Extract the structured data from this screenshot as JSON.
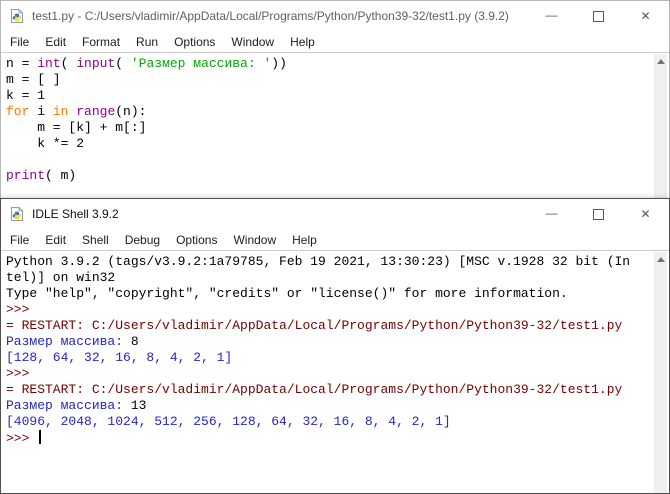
{
  "colors": {
    "plain": "#000000",
    "keyword": "#ff7700",
    "builtin": "#900090",
    "string": "#00aa00",
    "stdout": "#2525cd",
    "console": "#770000"
  },
  "editor_window": {
    "title": "test1.py - C:/Users/vladimir/AppData/Local/Programs/Python/Python39-32/test1.py (3.9.2)",
    "menu": [
      "File",
      "Edit",
      "Format",
      "Run",
      "Options",
      "Window",
      "Help"
    ],
    "controls": {
      "minimize": "—",
      "close": "✕"
    },
    "code_lines": [
      [
        {
          "t": "n = ",
          "c": "plain"
        },
        {
          "t": "int",
          "c": "builtin"
        },
        {
          "t": "( ",
          "c": "plain"
        },
        {
          "t": "input",
          "c": "builtin"
        },
        {
          "t": "( ",
          "c": "plain"
        },
        {
          "t": "'Размер массива: '",
          "c": "string"
        },
        {
          "t": "))",
          "c": "plain"
        }
      ],
      [
        {
          "t": "m = [ ]",
          "c": "plain"
        }
      ],
      [
        {
          "t": "k = 1",
          "c": "plain"
        }
      ],
      [
        {
          "t": "for",
          "c": "kw"
        },
        {
          "t": " i ",
          "c": "plain"
        },
        {
          "t": "in",
          "c": "kw"
        },
        {
          "t": " ",
          "c": "plain"
        },
        {
          "t": "range",
          "c": "builtin"
        },
        {
          "t": "(n):",
          "c": "plain"
        }
      ],
      [
        {
          "t": "    m = [k] + m[:]",
          "c": "plain"
        }
      ],
      [
        {
          "t": "    k *= 2",
          "c": "plain"
        }
      ],
      [
        {
          "t": "",
          "c": "plain"
        }
      ],
      [
        {
          "t": "print",
          "c": "builtin"
        },
        {
          "t": "( m)",
          "c": "plain"
        }
      ]
    ]
  },
  "shell_window": {
    "title": "IDLE Shell 3.9.2",
    "menu": [
      "File",
      "Edit",
      "Shell",
      "Debug",
      "Options",
      "Window",
      "Help"
    ],
    "controls": {
      "minimize": "—",
      "close": "✕"
    },
    "lines": [
      [
        {
          "t": "Python 3.9.2 (tags/v3.9.2:1a79785, Feb 19 2021, 13:30:23) [MSC v.1928 32 bit (In",
          "c": "plain"
        }
      ],
      [
        {
          "t": "tel)] on win32",
          "c": "plain"
        }
      ],
      [
        {
          "t": "Type \"help\", \"copyright\", \"credits\" or \"license()\" for more information.",
          "c": "plain"
        }
      ],
      [
        {
          "t": ">>> ",
          "c": "console"
        }
      ],
      [
        {
          "t": "= RESTART: C:/Users/vladimir/AppData/Local/Programs/Python/Python39-32/test1.py",
          "c": "console"
        }
      ],
      [
        {
          "t": "Размер массива: ",
          "c": "stdout"
        },
        {
          "t": "8",
          "c": "plain"
        }
      ],
      [
        {
          "t": "[128, 64, 32, 16, 8, 4, 2, 1]",
          "c": "stdout"
        }
      ],
      [
        {
          "t": ">>> ",
          "c": "console"
        }
      ],
      [
        {
          "t": "= RESTART: C:/Users/vladimir/AppData/Local/Programs/Python/Python39-32/test1.py",
          "c": "console"
        }
      ],
      [
        {
          "t": "Размер массива: ",
          "c": "stdout"
        },
        {
          "t": "13",
          "c": "plain"
        }
      ],
      [
        {
          "t": "[4096, 2048, 1024, 512, 256, 128, 64, 32, 16, 8, 4, 2, 1]",
          "c": "stdout"
        }
      ],
      [
        {
          "t": ">>> ",
          "c": "console"
        },
        {
          "caret": true
        }
      ]
    ]
  }
}
